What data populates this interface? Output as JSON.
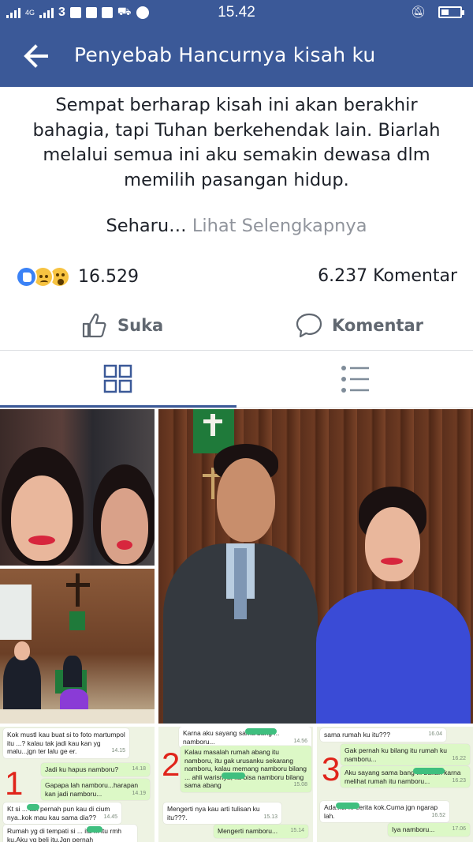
{
  "status_bar": {
    "time": "15.42",
    "network_label": "4G",
    "sim_label": "3"
  },
  "app_bar": {
    "title": "Penyebab Hancurnya kisah ku"
  },
  "post": {
    "text_lines": [
      "Sempat berharap kisah ini akan berakhir",
      "bahagia,  tapi Tuhan berkehendak lain.  Biarlah",
      "melalui semua ini aku semakin dewasa dlm",
      "memilih pasangan hidup."
    ],
    "truncated_text": "Seharu…",
    "see_more_label": "Lihat Selengkapnya"
  },
  "reactions": {
    "icons": [
      "like-icon",
      "sad-icon",
      "wow-icon"
    ],
    "count": "16.529",
    "comments_count": "6.237 Komentar"
  },
  "actions": {
    "like_label": "Suka",
    "comment_label": "Komentar"
  },
  "view_tabs": {
    "active": "grid",
    "icons": [
      "grid-icon",
      "list-icon"
    ],
    "accent_color": "#3b5998"
  },
  "colors": {
    "brand": "#3b5998",
    "text": "#1d2129",
    "muted": "#90949c",
    "chat_number": "#e0241b"
  },
  "chat_screenshots": [
    {
      "number": "1",
      "messages": [
        {
          "text": "Kok mustI kau buat si to foto martumpol itu ...? kalau tak jadi kau kan yg malu...jgn ter lalu ge er.",
          "time": "14.15",
          "own": false
        },
        {
          "text": "Jadi ku hapus namboru?",
          "time": "14.18",
          "own": true
        },
        {
          "text": "Gapapa lah namboru...harapan kan jadi namboru...",
          "time": "14.19",
          "own": true
        },
        {
          "text": "Kt si ... tak pernah pun kau di cium nya..kok mau kau sama dia??",
          "time": "14.45",
          "own": false
        },
        {
          "text": "Rumah yg di tempati si ... itu ... itu rmh ku.Aku yg beli itu.Jgn pernah",
          "time": "",
          "own": false
        }
      ]
    },
    {
      "number": "2",
      "messages": [
        {
          "text": "Karna aku sayang sama bang ... namboru...",
          "time": "14.56",
          "own": false
        },
        {
          "text": "Kalau masalah rumah abang itu namboru, itu gak urusanku sekarang namboru, kalau memang namboru bilang ... ahli warisnya, itu bisa namboru bilang sama abang",
          "time": "15.08",
          "own": true
        },
        {
          "text": "Mengerti nya kau arti tulisan ku itu???.",
          "time": "15.13",
          "own": false
        },
        {
          "text": "Mengerti namboru...",
          "time": "15.14",
          "own": true
        }
      ]
    },
    {
      "number": "3",
      "messages": [
        {
          "text": "sama rumah ku itu???",
          "time": "16.04",
          "own": false
        },
        {
          "text": "Gak pernah ku bilang itu rumah ku namboru...",
          "time": "16.22",
          "own": true
        },
        {
          "text": "Aku sayang sama bang ... bukan karna melihat rumah itu namboru...",
          "time": "16.23",
          "own": true
        },
        {
          "text": "Ada...si ... cerita kok.Cuma jgn ngarap lah.",
          "time": "16.52",
          "own": false
        },
        {
          "text": "Iya namboru...",
          "time": "17.06",
          "own": true
        }
      ]
    }
  ]
}
